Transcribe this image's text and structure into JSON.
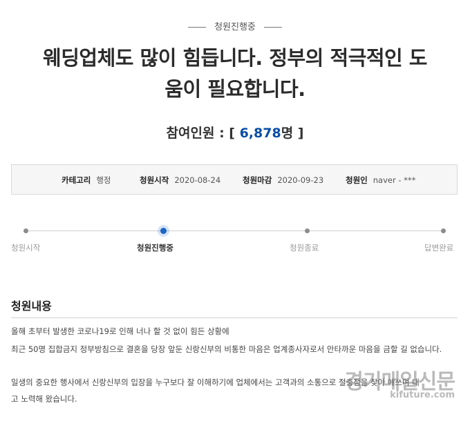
{
  "status": {
    "label": "청원진행중"
  },
  "petition": {
    "title_line1": "웨딩업체도 많이 힘듭니다. 정부의 적극적인 도",
    "title_line2": "움이 필요합니다.",
    "participants_prefix": "참여인원 : [ ",
    "participants_count": "6,878",
    "participants_suffix": "명 ]"
  },
  "info": {
    "category_label": "카테고리",
    "category_value": "행정",
    "start_label": "청원시작",
    "start_value": "2020-08-24",
    "deadline_label": "청원마감",
    "deadline_value": "2020-09-23",
    "petitioner_label": "청원인",
    "petitioner_value": "naver - ***"
  },
  "progress": {
    "steps": [
      {
        "label": "청원시작",
        "active": false
      },
      {
        "label": "청원진행중",
        "active": true
      },
      {
        "label": "청원종료",
        "active": false
      },
      {
        "label": "답변완료",
        "active": false
      }
    ]
  },
  "content": {
    "section_title": "청원내용",
    "lines": [
      "올해 초부터 발생한 코로나19로 인해 너나 할 것 없이 힘든 상황에",
      "최근 50명 집합금지 정부방침으로 결혼을 당장 앞둔 신랑신부의 비통한 마음은 업계종사자로서 안타까운 마음을 금할 길 없습니다.",
      "일생의 중요한 행사에서 신랑신부의 입장을 누구보다 잘 이해하기에 업체에서는 고객과의 소통으로 절충점을 찾아 애쓰며 대",
      "고 노력해 왔습니다."
    ]
  },
  "watermark": {
    "main": "경기매일신문",
    "sub": "kifuture.com"
  }
}
